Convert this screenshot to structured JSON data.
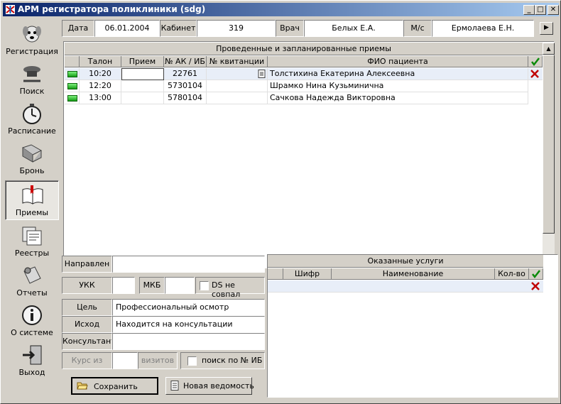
{
  "window": {
    "title": "АРМ регистратора поликлиники (sdg)"
  },
  "sidebar": {
    "items": [
      {
        "label": "Регистрация",
        "icon": "dog-face-icon"
      },
      {
        "label": "Поиск",
        "icon": "search-icon"
      },
      {
        "label": "Расписание",
        "icon": "stopwatch-icon"
      },
      {
        "label": "Бронь",
        "icon": "reservation-icon"
      },
      {
        "label": "Приемы",
        "icon": "book-icon",
        "active": true
      },
      {
        "label": "Реестры",
        "icon": "documents-icon"
      },
      {
        "label": "Отчеты",
        "icon": "report-icon"
      },
      {
        "label": "О системе",
        "icon": "info-icon"
      },
      {
        "label": "Выход",
        "icon": "exit-door-icon"
      }
    ]
  },
  "header": {
    "date_label": "Дата",
    "date_value": "06.01.2004",
    "cabinet_label": "Кабинет",
    "cabinet_value": "319",
    "doctor_label": "Врач",
    "doctor_value": "Белых Е.А.",
    "nurse_label": "М/с",
    "nurse_value": "Ермолаева Е.Н."
  },
  "appointments": {
    "title": "Проведенные и запланированные приемы",
    "columns": [
      "Талон",
      "Прием",
      "№ АК / ИБ",
      "№ квитанции",
      "ФИО пациента"
    ],
    "rows": [
      {
        "time": "10:20",
        "visit": "",
        "card": "22761",
        "receipt": "",
        "patient": "Толстихина Екатерина Алексеевна"
      },
      {
        "time": "12:20",
        "visit": "",
        "card": "5730104",
        "receipt": "",
        "patient": "Шрамко Нина Кузьминична"
      },
      {
        "time": "13:00",
        "visit": "",
        "card": "5780104",
        "receipt": "",
        "patient": "Сачкова Надежда Викторовна"
      }
    ]
  },
  "form": {
    "directed_label": "Направлен",
    "directed_value": "",
    "ukk_label": "УКК",
    "ukk_value": "",
    "mkb_label": "МКБ",
    "mkb_value": "",
    "ds_mismatch_label": "DS не совпал",
    "goal_label": "Цель",
    "goal_value": "Профессиональный осмотр",
    "outcome_label": "Исход",
    "outcome_value": "Находится на консультации",
    "consultant_label": "Консультант",
    "consultant_value": "",
    "course_label": "Курс из",
    "course_value": "",
    "visits_label": "визитов",
    "search_ib_label": "поиск по № ИБ"
  },
  "services": {
    "title": "Оказанные услуги",
    "columns": [
      "Шифр",
      "Наименование",
      "Кол-во"
    ]
  },
  "buttons": {
    "save": "Сохранить",
    "new_sheet": "Новая ведомость"
  },
  "colors": {
    "title_start": "#0a246a",
    "title_end": "#a6caf0",
    "selected_row": "#e8eef8"
  }
}
